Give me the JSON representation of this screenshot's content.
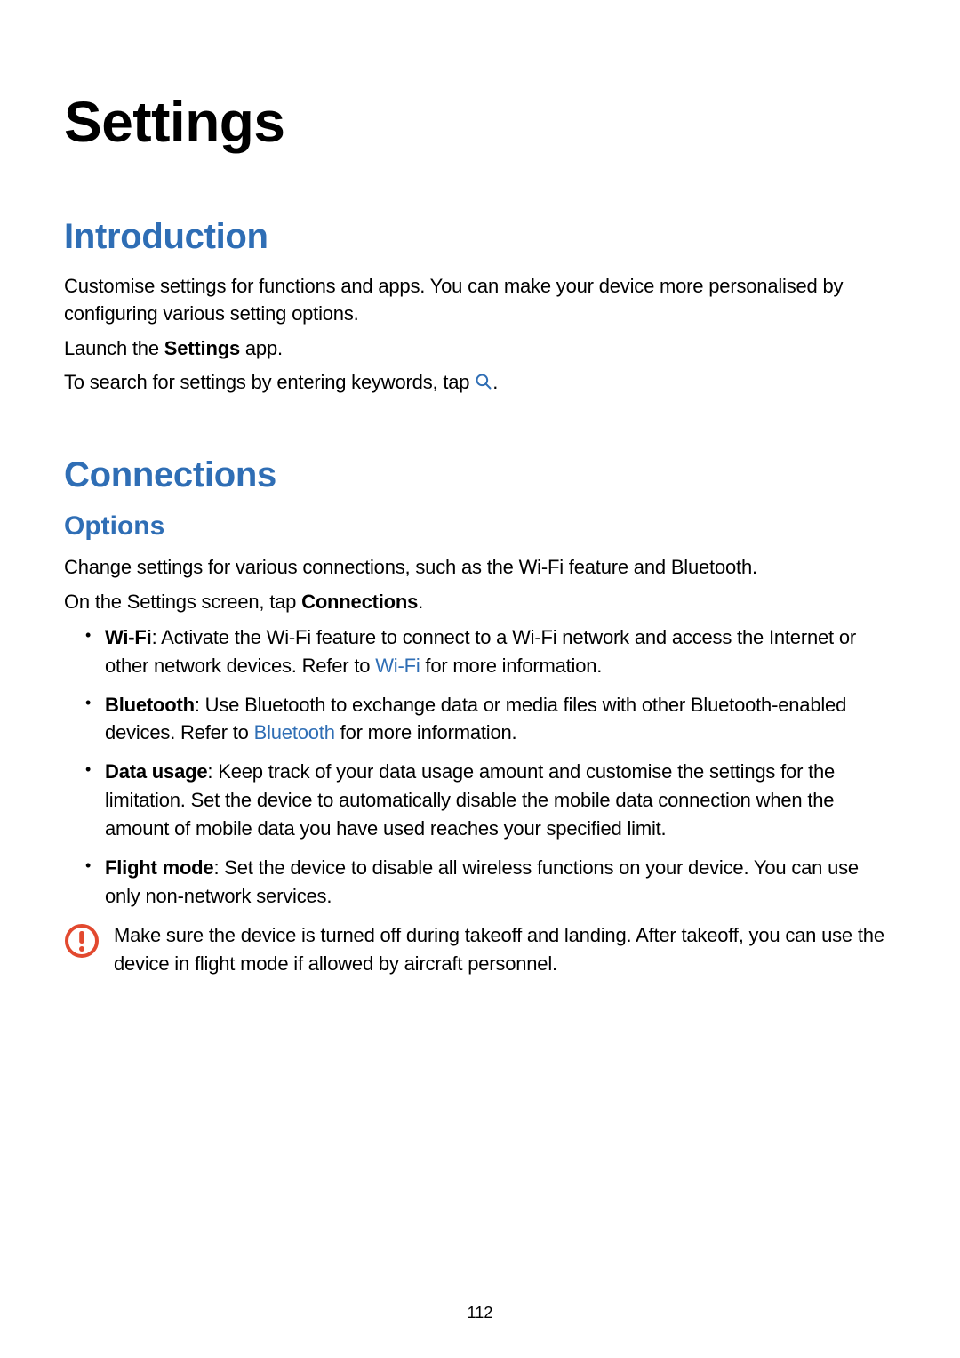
{
  "page_number": "112",
  "title": "Settings",
  "intro": {
    "heading": "Introduction",
    "p1": "Customise settings for functions and apps. You can make your device more personalised by configuring various setting options.",
    "p2_pre": "Launch the ",
    "p2_bold": "Settings",
    "p2_post": " app.",
    "p3_pre": "To search for settings by entering keywords, tap ",
    "p3_post": "."
  },
  "connections": {
    "heading": "Connections",
    "sub": "Options",
    "p1": "Change settings for various connections, such as the Wi-Fi feature and Bluetooth.",
    "p2_pre": "On the Settings screen, tap ",
    "p2_bold": "Connections",
    "p2_post": ".",
    "items": {
      "wifi": {
        "label": "Wi-Fi",
        "text_pre": ": Activate the Wi-Fi feature to connect to a Wi-Fi network and access the Internet or other network devices. Refer to ",
        "link": "Wi-Fi",
        "text_post": " for more information."
      },
      "bluetooth": {
        "label": "Bluetooth",
        "text_pre": ": Use Bluetooth to exchange data or media files with other Bluetooth-enabled devices. Refer to ",
        "link": "Bluetooth",
        "text_post": " for more information."
      },
      "data": {
        "label": "Data usage",
        "text": ": Keep track of your data usage amount and customise the settings for the limitation. Set the device to automatically disable the mobile data connection when the amount of mobile data you have used reaches your specified limit."
      },
      "flight": {
        "label": "Flight mode",
        "text": ": Set the device to disable all wireless functions on your device. You can use only non-network services."
      }
    },
    "callout": "Make sure the device is turned off during takeoff and landing. After takeoff, you can use the device in flight mode if allowed by aircraft personnel."
  }
}
